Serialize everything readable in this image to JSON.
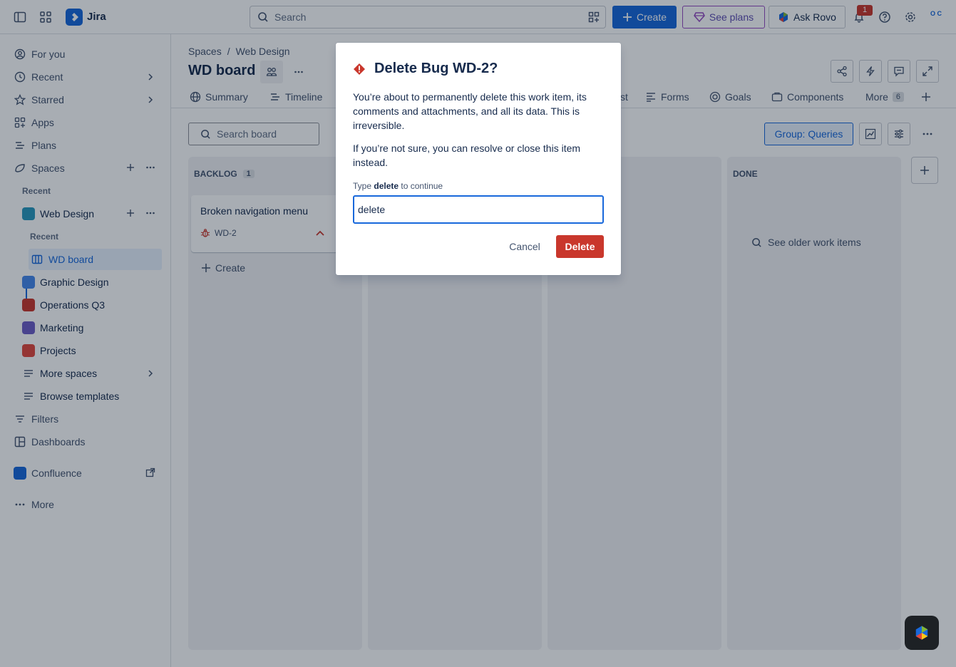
{
  "topbar": {
    "app_name": "Jira",
    "search_placeholder": "Search",
    "create_label": "Create",
    "plans_label": "See plans",
    "rovo_label": "Ask Rovo",
    "notification_count": "1",
    "avatar_text": "O C"
  },
  "sidebar": {
    "for_you": "For you",
    "recent": "Recent",
    "starred": "Starred",
    "apps": "Apps",
    "plans": "Plans",
    "spaces": "Spaces",
    "recent_section": "Recent",
    "web_design": "Web Design",
    "web_design_recent": "Recent",
    "wd_board": "WD board",
    "graphic_design": "Graphic Design",
    "operations": "Operations Q3",
    "marketing": "Marketing",
    "projects": "Projects",
    "more_spaces": "More spaces",
    "browse_templates": "Browse templates",
    "filters": "Filters",
    "dashboards": "Dashboards",
    "confluence": "Confluence",
    "more": "More"
  },
  "main": {
    "breadcrumb_root": "Spaces",
    "breadcrumb_sep": "/",
    "breadcrumb_space": "Web Design",
    "title": "WD board",
    "tabs": {
      "summary": "Summary",
      "timeline": "Timeline",
      "list_fragment": "st",
      "forms": "Forms",
      "goals": "Goals",
      "components": "Components",
      "more": "More",
      "more_count": "6"
    },
    "board_search_placeholder": "Search board",
    "group_button": "Group: Queries",
    "backlog": {
      "title": "BACKLOG",
      "count": "1"
    },
    "done": {
      "title": "DONE"
    },
    "card": {
      "title": "Broken navigation menu",
      "key": "WD-2"
    },
    "create_label": "Create",
    "older_items": "See older work items"
  },
  "modal": {
    "title": "Delete Bug WD-2?",
    "paragraph1": "You’re about to permanently delete this work item, its comments and attachments, and all its data. This is irreversible.",
    "paragraph2": "If you’re not sure, you can resolve or close this item instead.",
    "label_prefix": "Type",
    "label_keyword": "delete",
    "label_suffix": "to continue",
    "input_value": "delete",
    "cancel_label": "Cancel",
    "delete_label": "Delete"
  },
  "colors": {
    "brand": "#1868db",
    "danger": "#c9372c",
    "plans": "#964ac0"
  }
}
